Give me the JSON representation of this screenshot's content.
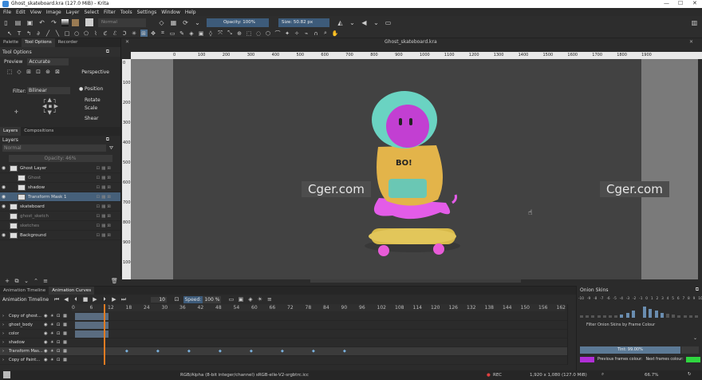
{
  "window": {
    "title": "Ghost_skateboard.kra (127.0 MiB) - Krita",
    "doc_tab": "Ghost_skateboard.kra"
  },
  "menu": [
    "File",
    "Edit",
    "View",
    "Image",
    "Layer",
    "Select",
    "Filter",
    "Tools",
    "Settings",
    "Window",
    "Help"
  ],
  "toolbar": {
    "blend_mode": "Normal",
    "opacity": "Opacity: 100%",
    "size": "Size: 50.82 px"
  },
  "left_tabs": [
    "Palette",
    "Tool Options",
    "Recorder"
  ],
  "tool_options": {
    "header": "Tool Options",
    "preview_label": "Preview",
    "preview_value": "Accurate",
    "perspective": "Perspective",
    "filter_label": "Filter:",
    "filter_value": "Bilinear",
    "modes": [
      "Position",
      "Rotate",
      "Scale",
      "Shear"
    ]
  },
  "layers_tabs": [
    "Layers",
    "Compositions"
  ],
  "layers": {
    "header": "Layers",
    "blend": "Normal",
    "opacity": "Opacity: 46%",
    "items": [
      {
        "name": "Ghost Layer",
        "selected": false,
        "dim": false
      },
      {
        "name": "Ghost",
        "selected": false,
        "dim": true
      },
      {
        "name": "shadow",
        "selected": false,
        "dim": false
      },
      {
        "name": "Transform Mask 1",
        "selected": true,
        "dim": false
      },
      {
        "name": "skateboard",
        "selected": false,
        "dim": false
      },
      {
        "name": "ghost_sketch",
        "selected": false,
        "dim": true
      },
      {
        "name": "sketches",
        "selected": false,
        "dim": true
      },
      {
        "name": "Background",
        "selected": false,
        "dim": false
      }
    ]
  },
  "ruler_h": [
    "0",
    "100",
    "200",
    "300",
    "400",
    "500",
    "600",
    "700",
    "800",
    "900",
    "1000",
    "1100",
    "1200",
    "1300",
    "1400",
    "1500",
    "1600",
    "1700",
    "1800",
    "1900"
  ],
  "ruler_v": [
    "0",
    "100",
    "200",
    "300",
    "400",
    "500",
    "600",
    "700",
    "800",
    "900",
    "1000"
  ],
  "watermark": "Cger.com",
  "timeline": {
    "tabs": [
      "Animation Timeline",
      "Animation Curves"
    ],
    "header": "Animation Timeline",
    "frame": "10",
    "speed_label": "Speed:",
    "speed": "100 %",
    "frames": [
      "0",
      "6",
      "12",
      "18",
      "24",
      "30",
      "36",
      "42",
      "48",
      "54",
      "60",
      "66",
      "72",
      "78",
      "84",
      "90",
      "96",
      "102",
      "108",
      "114",
      "120",
      "126",
      "132",
      "138",
      "144",
      "150",
      "156",
      "162"
    ],
    "rows": [
      "Copy of ghost...",
      "ghost_body",
      "color",
      "shadow",
      "Transform Mas...",
      "Copy of Paint..."
    ]
  },
  "onion": {
    "header": "Onion Skins",
    "numbers": [
      "-10",
      "-9",
      "-8",
      "-7",
      "-6",
      "-5",
      "-4",
      "-3",
      "-2",
      "-1",
      "0",
      "1",
      "2",
      "3",
      "4",
      "5",
      "6",
      "7",
      "8",
      "9",
      "10"
    ],
    "filter": "Filter Onion Skins by Frame Colour",
    "tint": "Tint: 99.00%",
    "prev": "Previous frames colour:",
    "next": "Next frames colour:",
    "prev_color": "#b02fd6",
    "next_color": "#2fd640"
  },
  "status": {
    "color": "RGB/Alpha (8-bit integer/channel)  sRGB-elle-V2-srgbtrc.icc",
    "rec": "REC",
    "size": "1,920 x 1,080 (127.0 MiB)",
    "zoom": "66.7%"
  }
}
